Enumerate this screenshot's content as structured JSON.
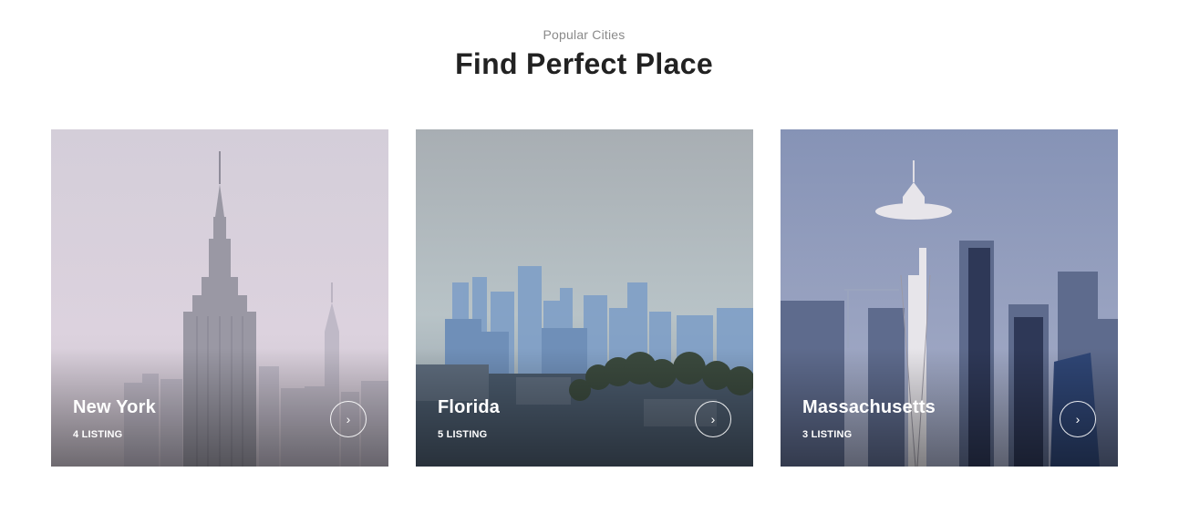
{
  "section": {
    "subtitle": "Popular Cities",
    "title": "Find Perfect Place"
  },
  "cards": [
    {
      "city": "New York",
      "listing": "4 LISTING",
      "arrow_icon": "chevron-right-icon"
    },
    {
      "city": "Florida",
      "listing": "5 LISTING",
      "arrow_icon": "chevron-right-icon"
    },
    {
      "city": "Massachusetts",
      "listing": "3 LISTING",
      "arrow_icon": "chevron-right-icon"
    }
  ],
  "arrow_glyph": "›",
  "colors": {
    "title": "#222222",
    "subtitle": "#8a8a8a",
    "overlay_text": "#ffffff"
  }
}
